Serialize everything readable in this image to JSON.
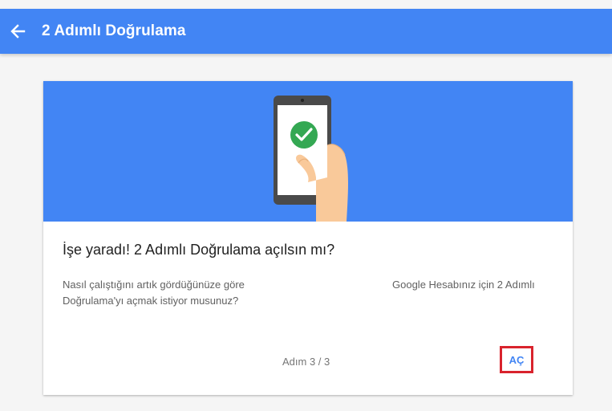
{
  "header": {
    "title": "2 Adımlı Doğrulama",
    "back_icon": "arrow-left-icon",
    "background_color": "#4285f4"
  },
  "card": {
    "heading": "İşe yaradı! 2 Adımlı Doğrulama açılsın mı?",
    "description_left_line1": "Nasıl çalıştığını artık gördüğünüze göre",
    "description_left_line2": "Doğrulama'yı açmak istiyor musunuz?",
    "description_right": "Google Hesabınız için 2 Adımlı",
    "step_indicator": "Adım 3 / 3",
    "open_button_label": "AÇ",
    "highlight_color": "#d9232d",
    "illustration_icons": [
      "phone-icon",
      "hand-icon",
      "checkmark-icon"
    ],
    "check_color": "#34a853"
  }
}
